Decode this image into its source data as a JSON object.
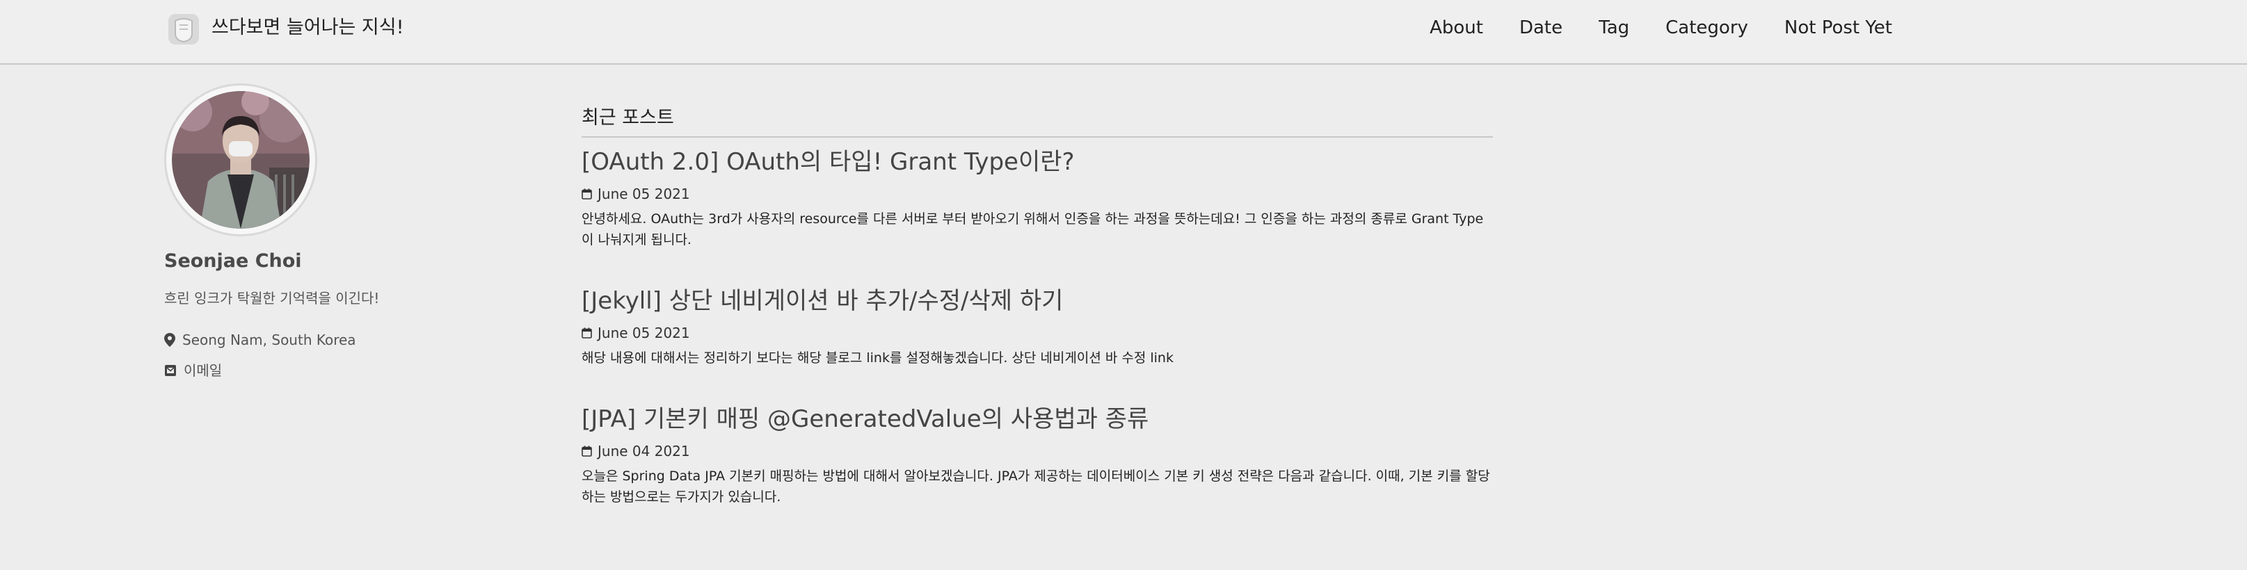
{
  "header": {
    "site_title": "쓰다보면 늘어나는 지식!",
    "logo_icon": "logo-icon",
    "nav": [
      {
        "label": "About"
      },
      {
        "label": "Date"
      },
      {
        "label": "Tag"
      },
      {
        "label": "Category"
      },
      {
        "label": "Not Post Yet"
      }
    ]
  },
  "sidebar": {
    "author_name": "Seonjae Choi",
    "bio": "흐린 잉크가 탁월한 기억력을 이긴다!",
    "location": "Seong Nam, South Korea",
    "location_icon": "map-marker-icon",
    "email_label": "이메일",
    "email_icon": "envelope-icon"
  },
  "main": {
    "section_title": "최근 포스트",
    "date_icon": "calendar-icon",
    "posts": [
      {
        "title": "[OAuth 2.0] OAuth의 타입! Grant Type이란?",
        "date": "June 05 2021",
        "excerpt": "안녕하세요. OAuth는 3rd가 사용자의 resource를 다른 서버로 부터 받아오기 위해서 인증을 하는 과정을 뜻하는데요! 그 인증을 하는 과정의 종류로 Grant Type이 나눠지게 됩니다."
      },
      {
        "title": "[Jekyll] 상단 네비게이션 바 추가/수정/삭제 하기",
        "date": "June 05 2021",
        "excerpt": "해당 내용에 대해서는 정리하기 보다는 해당 블로그 link를 설정해놓겠습니다. 상단 네비게이션 바 수정 link"
      },
      {
        "title": "[JPA] 기본키 매핑 @GeneratedValue의 사용법과 종류",
        "date": "June 04 2021",
        "excerpt": "오늘은 Spring Data JPA 기본키 매핑하는 방법에 대해서 알아보겠습니다. JPA가 제공하는 데이터베이스 기본 키 생성 전략은 다음과 같습니다. 이때, 기본 키를 할당하는 방법으로는 두가지가 있습니다."
      }
    ]
  }
}
